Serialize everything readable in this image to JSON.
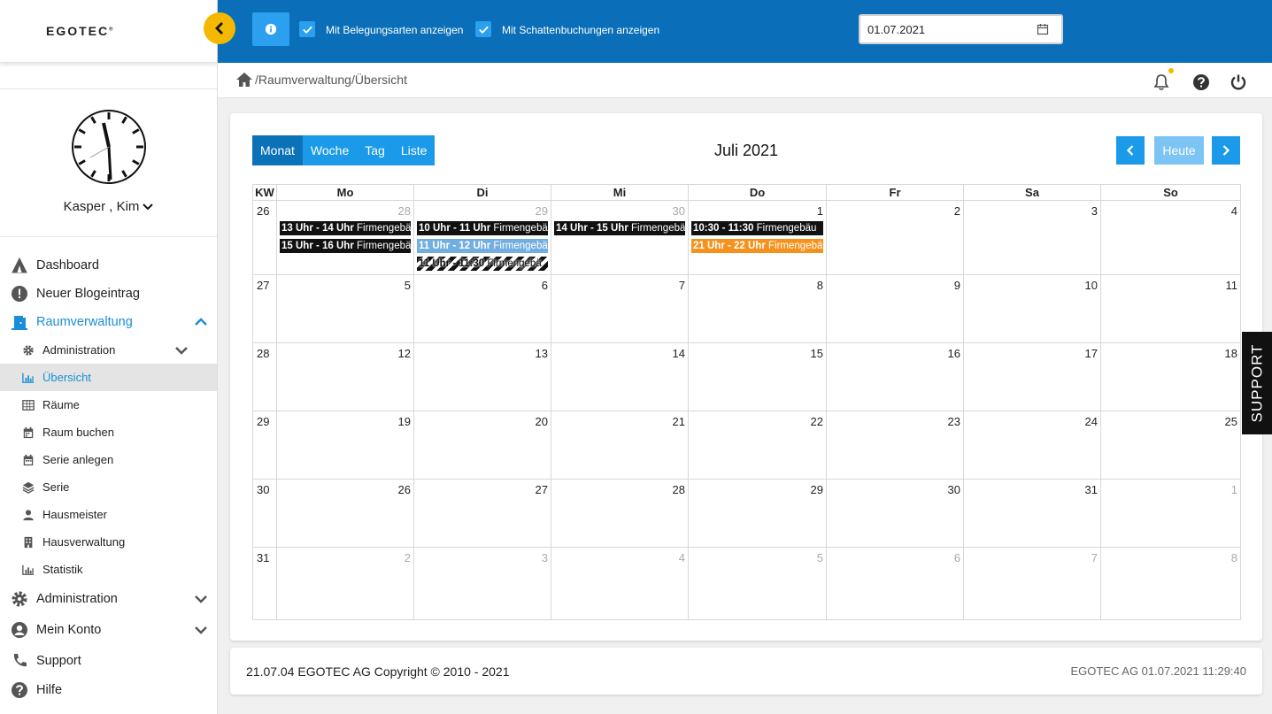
{
  "brand": {
    "logo": "EGOTEC",
    "logo_mark": "®"
  },
  "user": {
    "name": "Kasper , Kim"
  },
  "nav": {
    "dashboard": "Dashboard",
    "blog": "Neuer Blogeintrag",
    "raumverwaltung": "Raumverwaltung",
    "sub": {
      "administration": "Administration",
      "uebersicht": "Übersicht",
      "raeume": "Räume",
      "raum_buchen": "Raum buchen",
      "serie_anlegen": "Serie anlegen",
      "serie": "Serie",
      "hausmeister": "Hausmeister",
      "hausverwaltung": "Hausverwaltung",
      "statistik": "Statistik"
    },
    "administration": "Administration",
    "mein_konto": "Mein Konto",
    "support": "Support",
    "hilfe": "Hilfe"
  },
  "topbar": {
    "chk1_label": "Mit Belegungsarten anzeigen",
    "chk2_label": "Mit Schattenbuchungen anzeigen",
    "date_value": "01.07.2021"
  },
  "breadcrumb": "/Raumverwaltung/Übersicht",
  "calendar": {
    "views": {
      "month": "Monat",
      "week": "Woche",
      "day": "Tag",
      "list": "Liste"
    },
    "title": "Juli 2021",
    "today": "Heute",
    "headers": {
      "kw": "KW",
      "mo": "Mo",
      "di": "Di",
      "mi": "Mi",
      "do": "Do",
      "fr": "Fr",
      "sa": "Sa",
      "so": "So"
    },
    "weeks": [
      {
        "kw": "26",
        "days": [
          "28",
          "29",
          "30",
          "1",
          "2",
          "3",
          "4"
        ]
      },
      {
        "kw": "27",
        "days": [
          "5",
          "6",
          "7",
          "8",
          "9",
          "10",
          "11"
        ]
      },
      {
        "kw": "28",
        "days": [
          "12",
          "13",
          "14",
          "15",
          "16",
          "17",
          "18"
        ]
      },
      {
        "kw": "29",
        "days": [
          "19",
          "20",
          "21",
          "22",
          "23",
          "24",
          "25"
        ]
      },
      {
        "kw": "30",
        "days": [
          "26",
          "27",
          "28",
          "29",
          "30",
          "31",
          "1"
        ]
      },
      {
        "kw": "31",
        "days": [
          "2",
          "3",
          "4",
          "5",
          "6",
          "7",
          "8"
        ]
      }
    ],
    "events": {
      "e1": {
        "time": "13 Uhr - 14 Uhr",
        "title": "Firmengebä"
      },
      "e2": {
        "time": "15 Uhr - 16 Uhr",
        "title": "Firmengebä"
      },
      "e3": {
        "time": "10 Uhr - 11 Uhr",
        "title": "Firmengebä"
      },
      "e4": {
        "time": "11 Uhr - 12 Uhr",
        "title": "Firmengebä"
      },
      "e5": {
        "time": "11 Uhr - 11:30",
        "title": "Firmengebä"
      },
      "e6": {
        "time": "14 Uhr - 15 Uhr",
        "title": "Firmengebä"
      },
      "e7": {
        "time": "10:30 - 11:30",
        "title": "Firmengebäu"
      },
      "e8": {
        "time": "21 Uhr - 22 Uhr",
        "title": "Firmengebä"
      }
    },
    "colors": {
      "black": "#111111",
      "blue": "#72aee0",
      "orange": "#f5921e"
    }
  },
  "footer": {
    "left": "21.07.04 EGOTEC AG Copyright © 2010 - 2021",
    "right": "EGOTEC AG  01.07.2021 11:29:40"
  },
  "support_tab": "SUPPORT",
  "colors": {
    "primary": "#0a6fb8",
    "accent": "#1a9ae8",
    "warning": "#f5b800"
  }
}
